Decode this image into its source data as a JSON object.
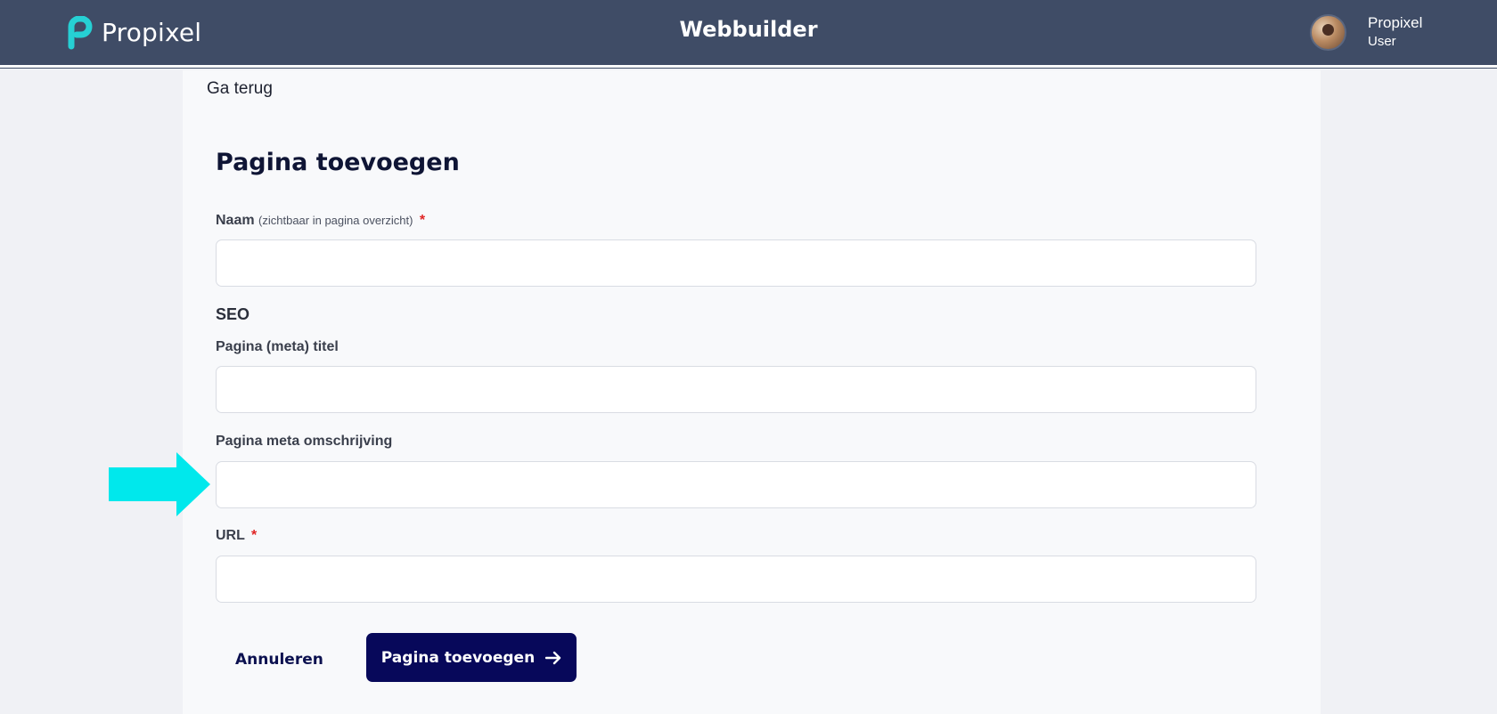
{
  "header": {
    "brand": "Propixel",
    "title": "Webbuilder",
    "user": {
      "name": "Propixel",
      "role": "User"
    }
  },
  "nav": {
    "back_label": "Ga terug"
  },
  "form": {
    "title": "Pagina toevoegen",
    "name_field": {
      "label": "Naam",
      "hint": "(zichtbaar in pagina overzicht)",
      "required_mark": "*",
      "value": ""
    },
    "seo_heading": "SEO",
    "meta_title_field": {
      "label": "Pagina (meta) titel",
      "value": ""
    },
    "meta_description_field": {
      "label": "Pagina meta omschrijving",
      "value": ""
    },
    "url_field": {
      "label": "URL",
      "required_mark": "*",
      "value": ""
    },
    "cancel_label": "Annuleren",
    "submit_label": "Pagina toevoegen"
  },
  "colors": {
    "header_bg": "#3f4c66",
    "primary": "#07085a",
    "required": "#e02424",
    "highlight_arrow": "#00e8ec",
    "logo_accent": "#26d0d4"
  },
  "icons": {
    "logo": "propixel-logo-icon",
    "submit": "arrow-right-icon",
    "annotation": "pointer-arrow-icon"
  }
}
